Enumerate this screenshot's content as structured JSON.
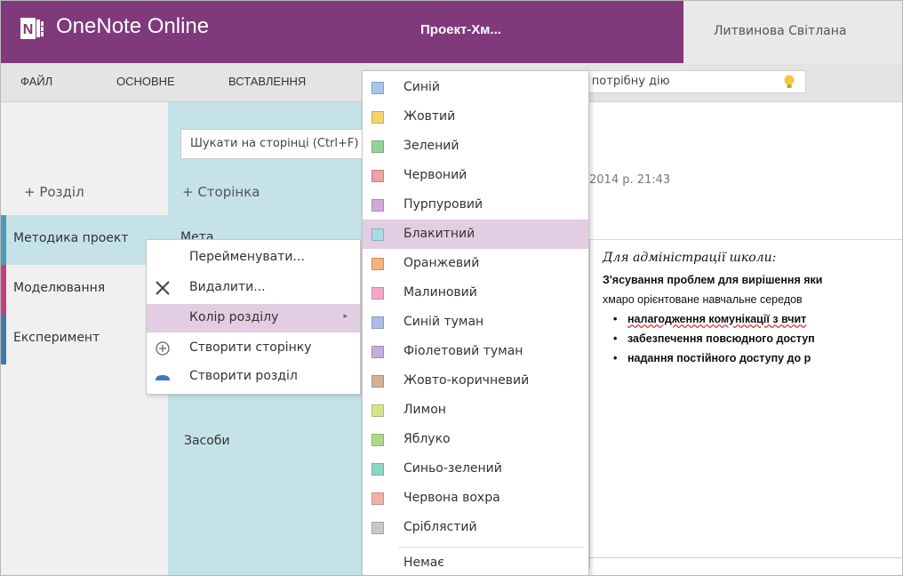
{
  "titlebar": {
    "app_name": "OneNote Online",
    "notebook_name": "Проект-Хм...",
    "user_name": "Литвинова Світлана",
    "color": "#80397b"
  },
  "ribbon": {
    "tabs": [
      "ФАЙЛ",
      "ОСНОВНЕ",
      "ВСТАВЛЕННЯ"
    ],
    "tellme_text": "ь потрібну дію"
  },
  "sections": {
    "add_label": "+   Розділ",
    "items": [
      {
        "label": "Методика проект",
        "color": "#4a9ab8"
      },
      {
        "label": "Моделювання",
        "color": "#c2407a"
      },
      {
        "label": "Експеримент",
        "color": "#3f78ad"
      }
    ]
  },
  "pages": {
    "search_placeholder": "Шукати на сторінці (Ctrl+F)",
    "add_label": "+   Сторінка",
    "items": [
      "Мета",
      "Засоби"
    ]
  },
  "context_menu": {
    "items": [
      {
        "label": "Перейменувати...",
        "icon": "none"
      },
      {
        "label": "Видалити...",
        "icon": "close-icon"
      },
      {
        "label": "Колір розділу",
        "icon": "none",
        "has_submenu": true
      },
      {
        "label": "Створити сторінку",
        "icon": "circle-plus-icon"
      },
      {
        "label": "Створити розділ",
        "icon": "section-tab-icon"
      }
    ],
    "submenu_arrow": "▸"
  },
  "color_menu": {
    "items": [
      {
        "label": "Синій",
        "color": "#a8c6e8"
      },
      {
        "label": "Жовтий",
        "color": "#f5d36c"
      },
      {
        "label": "Зелений",
        "color": "#93d29a"
      },
      {
        "label": "Червоний",
        "color": "#f0a0a0"
      },
      {
        "label": "Пурпуровий",
        "color": "#d2a8d8"
      },
      {
        "label": "Блакитний",
        "color": "#a6dce2"
      },
      {
        "label": "Оранжевий",
        "color": "#f6b27a"
      },
      {
        "label": "Малиновий",
        "color": "#f4a8c8"
      },
      {
        "label": "Синій туман",
        "color": "#aebbe4"
      },
      {
        "label": "Фіолетовий туман",
        "color": "#c4b0dc"
      },
      {
        "label": "Жовто-коричневий",
        "color": "#d2b096"
      },
      {
        "label": "Лимон",
        "color": "#d6e48e"
      },
      {
        "label": "Яблуко",
        "color": "#b0d88a"
      },
      {
        "label": "Синьо-зелений",
        "color": "#8ed6c4"
      },
      {
        "label": "Червона вохра",
        "color": "#f2b0aa"
      },
      {
        "label": "Сріблястий",
        "color": "#c8c8c8"
      }
    ],
    "none_label": "Немає",
    "highlight_color": "#e3cde2"
  },
  "content": {
    "date": "2014 р.   21:43",
    "note_title": "Для адміністрації школи:",
    "lines": [
      "З'ясування проблем для вирішення яки",
      "хмаро орієнтоване навчальне середов"
    ],
    "bullets": [
      "налагодження комунікації з вчит",
      "забезпечення повсюдного доступ",
      "надання постійного доступу до р"
    ]
  }
}
